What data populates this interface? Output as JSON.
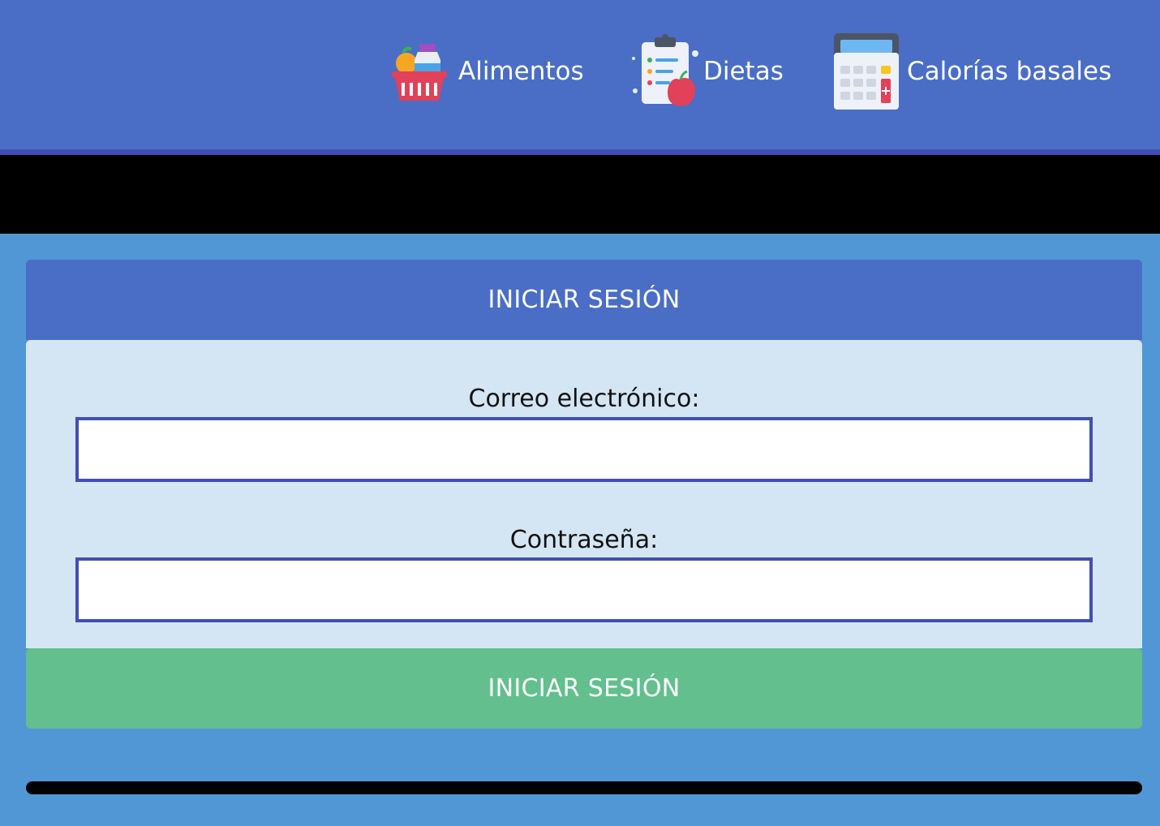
{
  "nav": {
    "items": [
      {
        "label": "Alimentos",
        "icon": "grocery-basket-icon"
      },
      {
        "label": "Dietas",
        "icon": "diet-clipboard-icon"
      },
      {
        "label": "Calorías basales",
        "icon": "calculator-icon"
      }
    ]
  },
  "login": {
    "header_title": "INICIAR SESIÓN",
    "email_label": "Correo electrónico:",
    "email_value": "",
    "password_label": "Contraseña:",
    "password_value": "",
    "submit_label": "INICIAR SESIÓN"
  },
  "colors": {
    "nav_bg": "#4a6dc6",
    "page_bg": "#5196d5",
    "card_body_bg": "#d4e5f4",
    "input_border": "#3f4fb5",
    "submit_bg": "#64bf8f"
  }
}
